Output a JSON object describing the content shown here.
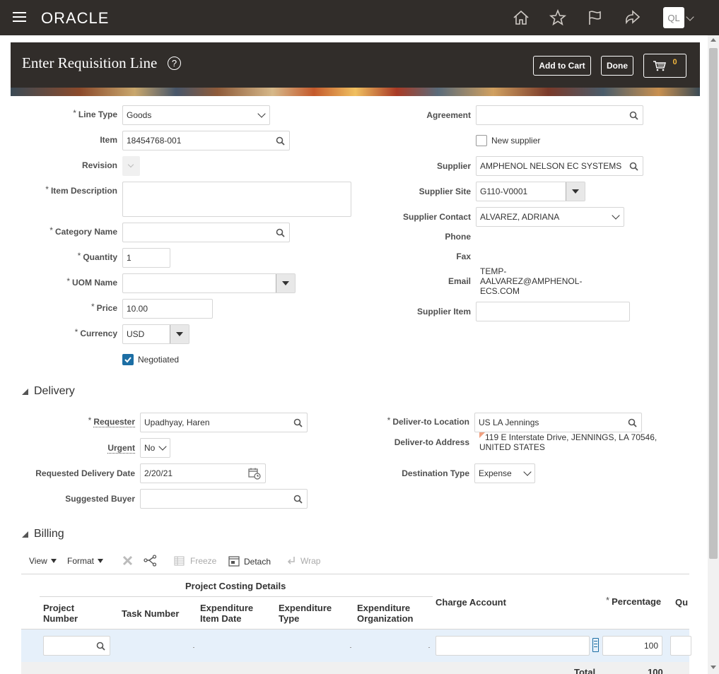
{
  "topbar": {
    "brand": "ORACLE",
    "avatar_initials": "QL",
    "icons": [
      "menu-icon",
      "home-icon",
      "favorites-icon",
      "notifications-icon",
      "navigator-icon"
    ]
  },
  "header": {
    "title": "Enter Requisition Line",
    "add_to_cart": "Add to Cart",
    "done": "Done",
    "cart_count": "0"
  },
  "form": {
    "line_type_label": "Line Type",
    "line_type_value": "Goods",
    "item_label": "Item",
    "item_value": "18454768-001",
    "revision_label": "Revision",
    "item_description_label": "Item Description",
    "item_description_value": "",
    "category_name_label": "Category Name",
    "category_name_value": "",
    "quantity_label": "Quantity",
    "quantity_value": "1",
    "uom_label": "UOM Name",
    "uom_value": "",
    "price_label": "Price",
    "price_value": "10.00",
    "currency_label": "Currency",
    "currency_value": "USD",
    "negotiated_label": "Negotiated",
    "negotiated_checked": true,
    "agreement_label": "Agreement",
    "agreement_value": "",
    "new_supplier_label": "New supplier",
    "supplier_label": "Supplier",
    "supplier_value": "AMPHENOL NELSON EC SYSTEMS",
    "supplier_site_label": "Supplier Site",
    "supplier_site_value": "G110-V0001",
    "supplier_contact_label": "Supplier Contact",
    "supplier_contact_value": "ALVAREZ, ADRIANA",
    "phone_label": "Phone",
    "fax_label": "Fax",
    "email_label": "Email",
    "email_line1": "TEMP-",
    "email_line2": "AALVAREZ@AMPHENOL-",
    "email_line3": "ECS.COM",
    "supplier_item_label": "Supplier Item",
    "supplier_item_value": ""
  },
  "delivery": {
    "section_title": "Delivery",
    "requester_label": "Requester",
    "requester_value": "Upadhyay, Haren",
    "urgent_label": "Urgent",
    "urgent_value": "No",
    "requested_date_label": "Requested Delivery Date",
    "requested_date_value": "2/20/21",
    "suggested_buyer_label": "Suggested Buyer",
    "suggested_buyer_value": "",
    "deliver_to_location_label": "Deliver-to Location",
    "deliver_to_location_value": "US LA Jennings",
    "deliver_to_address_label": "Deliver-to Address",
    "deliver_to_address_line1": "119 E Interstate Drive, JENNINGS, LA 70546,",
    "deliver_to_address_line2": "UNITED STATES",
    "destination_type_label": "Destination Type",
    "destination_type_value": "Expense"
  },
  "billing": {
    "section_title": "Billing",
    "toolbar": {
      "view": "View",
      "format": "Format",
      "freeze": "Freeze",
      "detach": "Detach",
      "wrap": "Wrap"
    },
    "group_header": "Project Costing Details",
    "columns": {
      "project_number_1": "Project",
      "project_number_2": "Number",
      "task_number": "Task Number",
      "exp_item_date_1": "Expenditure",
      "exp_item_date_2": "Item Date",
      "exp_type_1": "Expenditure",
      "exp_type_2": "Type",
      "exp_org_1": "Expenditure",
      "exp_org_2": "Organization",
      "charge_account": "Charge Account",
      "percentage": "Percentage",
      "quantity": "Qu"
    },
    "row": {
      "percentage": "100"
    },
    "total_label": "Total",
    "total_value": "100"
  },
  "colors": {
    "topbar": "#312d2a",
    "row_highlight": "#e6f0fa",
    "checkbox": "#1c6ea4"
  }
}
